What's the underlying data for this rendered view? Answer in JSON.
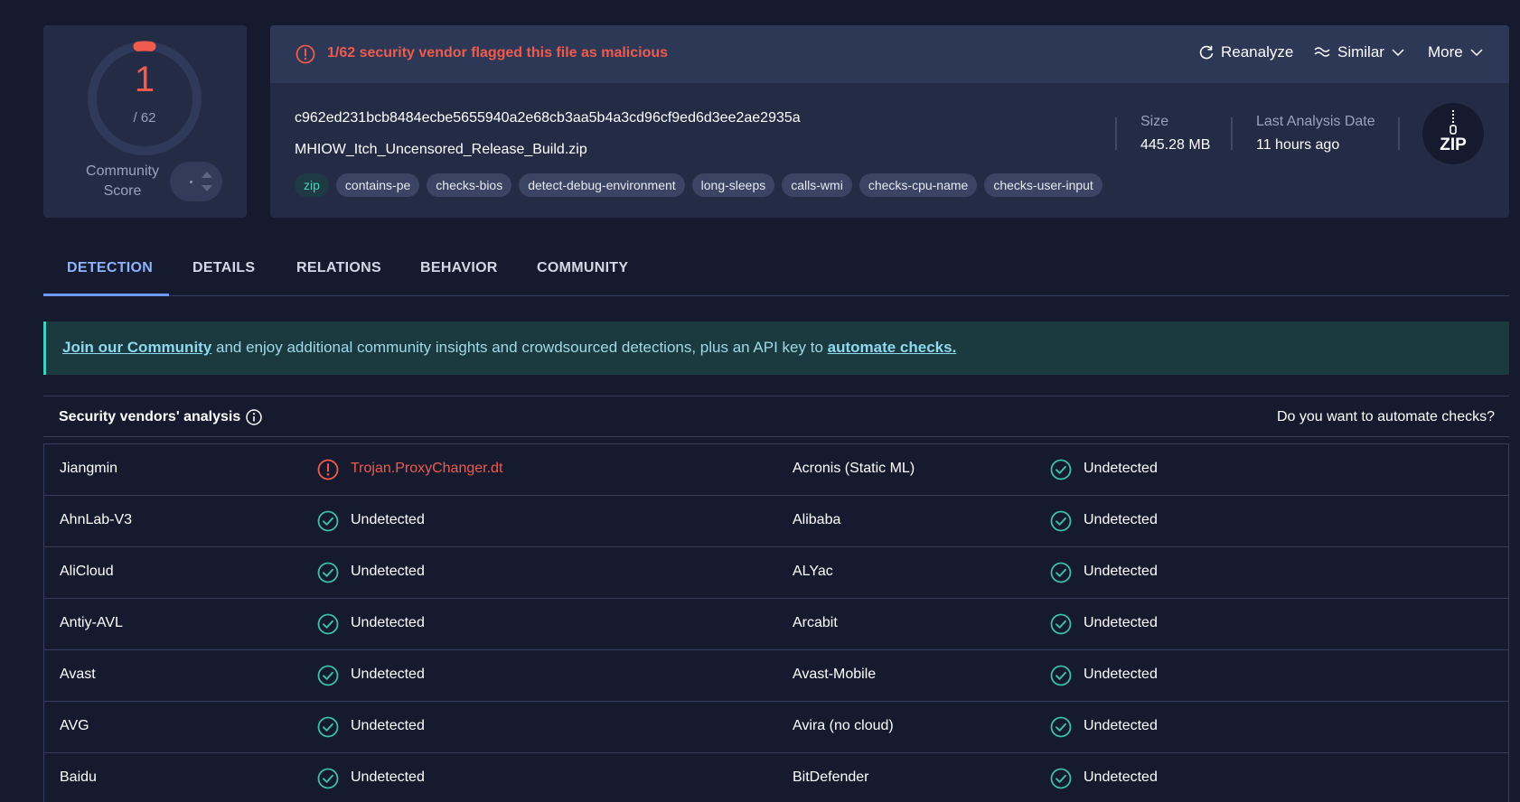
{
  "score": {
    "value": "1",
    "total": "/ 62",
    "community_label_line1": "Community",
    "community_label_line2": "Score",
    "colors": {
      "detected": "#ef5b4d",
      "ring": "#2f3959"
    }
  },
  "alert": {
    "text": "1/62 security vendor flagged this file as malicious",
    "icon": "alert-circle-icon",
    "color": "#ef5b4d"
  },
  "actions": {
    "reanalyze": "Reanalyze",
    "similar": "Similar",
    "more": "More"
  },
  "file": {
    "hash": "c962ed231bcb8484ecbe5655940a2e68cb3aa5b4a3cd96cf9ed6d3ee2ae2935a",
    "name": "MHIOW_Itch_Uncensored_Release_Build.zip",
    "tags": [
      "zip",
      "contains-pe",
      "checks-bios",
      "detect-debug-environment",
      "long-sleeps",
      "calls-wmi",
      "checks-cpu-name",
      "checks-user-input"
    ],
    "size_label": "Size",
    "size_value": "445.28 MB",
    "date_label": "Last Analysis Date",
    "date_value": "11 hours ago",
    "type_badge": "ZIP",
    "type_icon": "zip-file-icon"
  },
  "tabs": [
    "DETECTION",
    "DETAILS",
    "RELATIONS",
    "BEHAVIOR",
    "COMMUNITY"
  ],
  "active_tab": "DETECTION",
  "banner": {
    "link1": "Join our Community",
    "middle": " and enjoy additional community insights and crowdsourced detections, plus an API key to ",
    "link2": "automate checks."
  },
  "vendors_header": {
    "title": "Security vendors' analysis",
    "right": "Do you want to automate checks?"
  },
  "vendors": [
    {
      "left": {
        "name": "Jiangmin",
        "result": "Trojan.ProxyChanger.dt",
        "status": "malicious"
      },
      "right": {
        "name": "Acronis (Static ML)",
        "result": "Undetected",
        "status": "undetected"
      }
    },
    {
      "left": {
        "name": "AhnLab-V3",
        "result": "Undetected",
        "status": "undetected"
      },
      "right": {
        "name": "Alibaba",
        "result": "Undetected",
        "status": "undetected"
      }
    },
    {
      "left": {
        "name": "AliCloud",
        "result": "Undetected",
        "status": "undetected"
      },
      "right": {
        "name": "ALYac",
        "result": "Undetected",
        "status": "undetected"
      }
    },
    {
      "left": {
        "name": "Antiy-AVL",
        "result": "Undetected",
        "status": "undetected"
      },
      "right": {
        "name": "Arcabit",
        "result": "Undetected",
        "status": "undetected"
      }
    },
    {
      "left": {
        "name": "Avast",
        "result": "Undetected",
        "status": "undetected"
      },
      "right": {
        "name": "Avast-Mobile",
        "result": "Undetected",
        "status": "undetected"
      }
    },
    {
      "left": {
        "name": "AVG",
        "result": "Undetected",
        "status": "undetected"
      },
      "right": {
        "name": "Avira (no cloud)",
        "result": "Undetected",
        "status": "undetected"
      }
    },
    {
      "left": {
        "name": "Baidu",
        "result": "Undetected",
        "status": "undetected"
      },
      "right": {
        "name": "BitDefender",
        "result": "Undetected",
        "status": "undetected"
      }
    }
  ],
  "status_colors": {
    "malicious": "#ef5b4d",
    "undetected": "#3ebfa7"
  }
}
